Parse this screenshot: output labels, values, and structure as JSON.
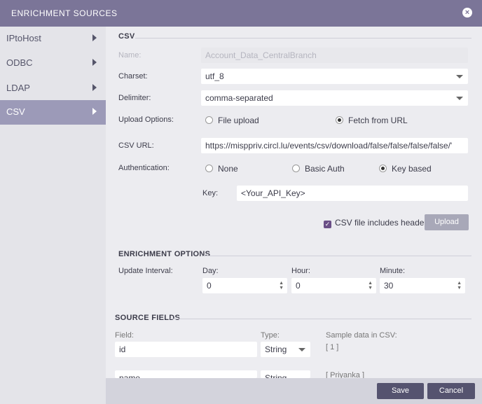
{
  "header": {
    "title": "ENRICHMENT SOURCES",
    "close_icon": "close-icon"
  },
  "sidebar": {
    "items": [
      {
        "label": "IPtoHost"
      },
      {
        "label": "ODBC"
      },
      {
        "label": "LDAP"
      },
      {
        "label": "CSV",
        "selected": true
      }
    ]
  },
  "csv": {
    "section": "CSV",
    "name_label": "Name:",
    "name_value": "Account_Data_CentralBranch",
    "charset_label": "Charset:",
    "charset_value": "utf_8",
    "delimiter_label": "Delimiter:",
    "delimiter_value": "comma-separated",
    "upload_label": "Upload Options:",
    "upload_file": "File upload",
    "upload_url": "Fetch from URL",
    "url_label": "CSV URL:",
    "url_value": "https://misppriv.circl.lu/events/csv/download/false/false/false/false/'",
    "auth_label": "Authentication:",
    "auth_none": "None",
    "auth_basic": "Basic Auth",
    "auth_key": "Key based",
    "key_label": "Key:",
    "key_value": "<Your_API_Key>",
    "header_checkbox": "CSV file includes header",
    "upload_button": "Upload"
  },
  "enrichment": {
    "section": "ENRICHMENT OPTIONS",
    "interval_label": "Update Interval:",
    "day_label": "Day:",
    "day_value": "0",
    "hour_label": "Hour:",
    "hour_value": "0",
    "minute_label": "Minute:",
    "minute_value": "30"
  },
  "source_fields": {
    "section": "SOURCE FIELDS",
    "field_label": "Field:",
    "type_label": "Type:",
    "sample_label": "Sample data in CSV:",
    "rows": [
      {
        "field": "id",
        "type": "String",
        "sample": "[ 1 ]"
      },
      {
        "field": "name",
        "type": "String",
        "sample": "[ Priyanka ]"
      }
    ]
  },
  "footer": {
    "save": "Save",
    "cancel": "Cancel"
  },
  "colors": {
    "header": "#7b7598",
    "selected": "#9c9ab8",
    "button": "#55536f"
  }
}
